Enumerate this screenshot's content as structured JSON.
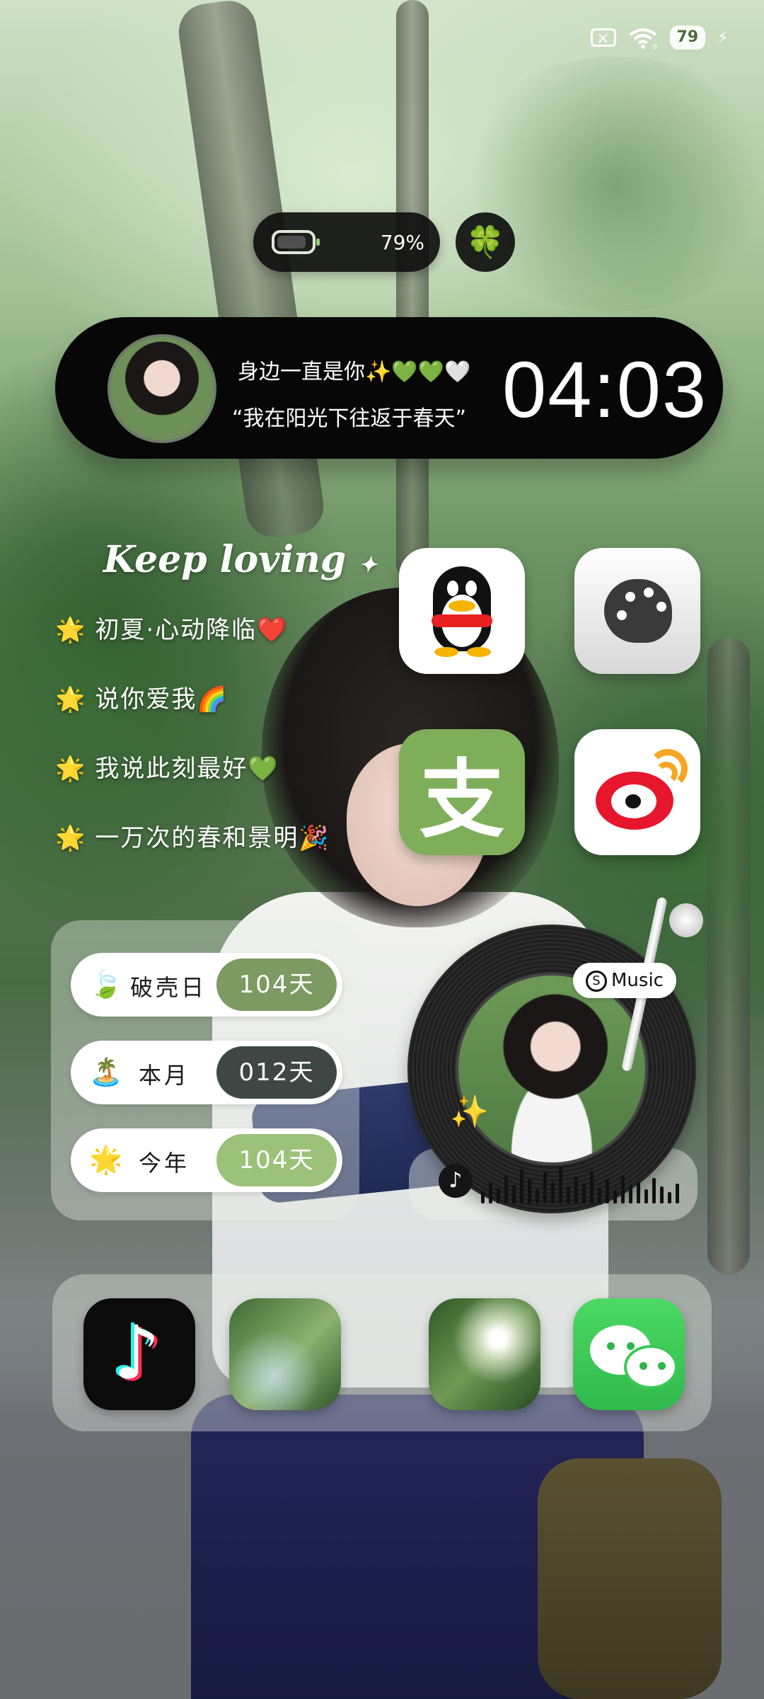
{
  "status_bar": {
    "no_sim_icon": "no-sim-icon",
    "signal_suffix": "6",
    "battery_level": "79",
    "charging_icon": "charging-bolt-icon"
  },
  "battery_widget": {
    "percent_text": "79%",
    "clover_icon": "🍀"
  },
  "profile_widget": {
    "line1": "身边一直是你✨💚💚🤍",
    "line2": "“我在阳光下往返于春天”",
    "time": "04:03"
  },
  "keep_loving": {
    "title": "Keep loving",
    "star": "✦",
    "lines": [
      "初夏·心动降临❤️",
      "说你爱我🌈",
      "我说此刻最好💚",
      "一万次的春和景明🎉"
    ],
    "bullet": "🌟"
  },
  "apps": {
    "qq": "qq-icon",
    "themes": "theme-palette-icon",
    "alipay_glyph": "支",
    "weibo": "weibo-icon"
  },
  "day_counter": {
    "rows": [
      {
        "icon": "🍃",
        "label": "破壳日",
        "value": "104天",
        "color": "#7c9a62"
      },
      {
        "icon": "🏝️",
        "label": "本月",
        "value": "012天",
        "color": "#3f4744"
      },
      {
        "icon": "🌟",
        "label": "今年",
        "value": "104天",
        "color": "#9cc27a"
      }
    ]
  },
  "music_widget": {
    "badge_text": "Music",
    "badge_glyph": "S",
    "note_glyph": "♪",
    "sparkle": "✨"
  },
  "dock": {
    "tiktok_glyph": "♪",
    "apps": [
      "tiktok-icon",
      "photo-widget-forest",
      "photo-widget-sunlight",
      "wechat-icon"
    ]
  },
  "colors": {
    "accent_green": "#7fae5b",
    "widget_black": "#070707",
    "weibo_red": "#e6162d",
    "wechat_green": "#4cd964"
  }
}
